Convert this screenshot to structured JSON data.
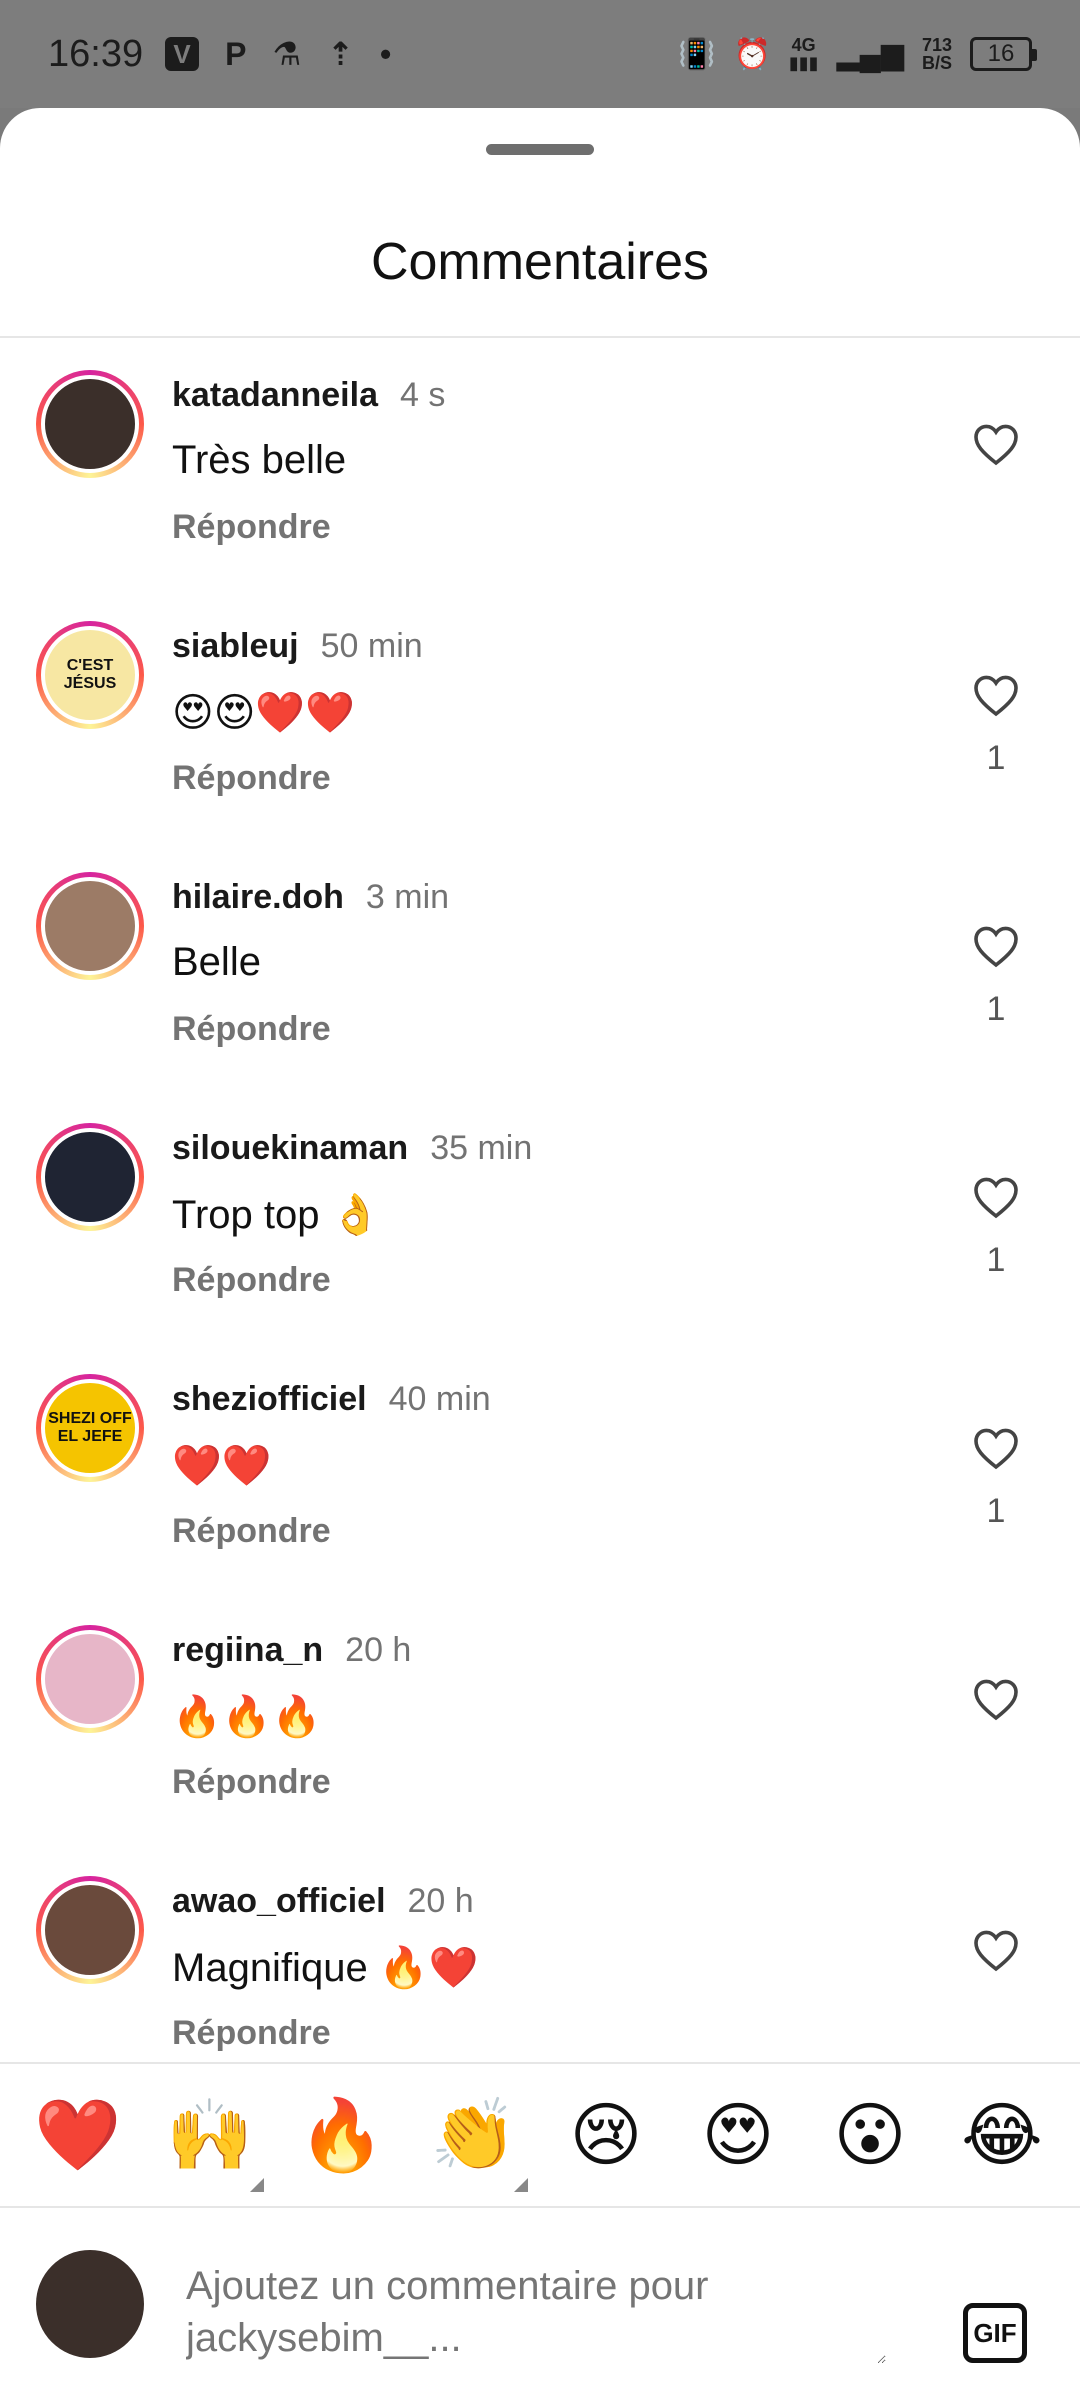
{
  "status_bar": {
    "time": "16:39",
    "network_type": "4G",
    "speed_value": "713",
    "speed_unit": "B/S",
    "battery": "16"
  },
  "sheet": {
    "title": "Commentaires"
  },
  "comments": [
    {
      "user": "katadanneila",
      "time": "4 s",
      "text": "Très belle",
      "reply": "Répondre",
      "likes": "",
      "avatar_color": "#3b2f2a"
    },
    {
      "user": "siableuj",
      "time": "50 min",
      "text": "😍😍❤️❤️",
      "reply": "Répondre",
      "likes": "1",
      "avatar_text": "C'EST JÉSUS",
      "avatar_color": "#f7e7a3"
    },
    {
      "user": "hilaire.doh",
      "time": "3 min",
      "text": "Belle",
      "reply": "Répondre",
      "likes": "1",
      "avatar_color": "#9c7b66"
    },
    {
      "user": "silouekinaman",
      "time": "35 min",
      "text": "Trop top 👌",
      "reply": "Répondre",
      "likes": "1",
      "avatar_color": "#1f2433"
    },
    {
      "user": "sheziofficiel",
      "time": "40 min",
      "text": "❤️❤️",
      "reply": "Répondre",
      "likes": "1",
      "avatar_text": "SHEZI OFF EL JEFE",
      "avatar_color": "#f5c400"
    },
    {
      "user": "regiina_n",
      "time": "20 h",
      "text": "🔥🔥🔥",
      "reply": "Répondre",
      "likes": "",
      "avatar_color": "#e7b6c8"
    },
    {
      "user": "awao_officiel",
      "time": "20 h",
      "text": "Magnifique 🔥❤️",
      "reply": "Répondre",
      "likes": "",
      "avatar_color": "#6a4a3c"
    }
  ],
  "emoji_bar": [
    {
      "emoji": "❤️",
      "has_variants": false
    },
    {
      "emoji": "🙌",
      "has_variants": true
    },
    {
      "emoji": "🔥",
      "has_variants": false
    },
    {
      "emoji": "👏",
      "has_variants": true
    },
    {
      "emoji": "😢",
      "has_variants": false
    },
    {
      "emoji": "😍",
      "has_variants": false
    },
    {
      "emoji": "😮",
      "has_variants": false
    },
    {
      "emoji": "😂",
      "has_variants": false
    }
  ],
  "composer": {
    "placeholder": "Ajoutez un commentaire pour jackysebim__...",
    "gif_label": "GIF"
  },
  "colors": {
    "accent_ring_start": "#d6249f",
    "accent_ring_mid": "#fd5949",
    "secondary_text": "#737373"
  }
}
